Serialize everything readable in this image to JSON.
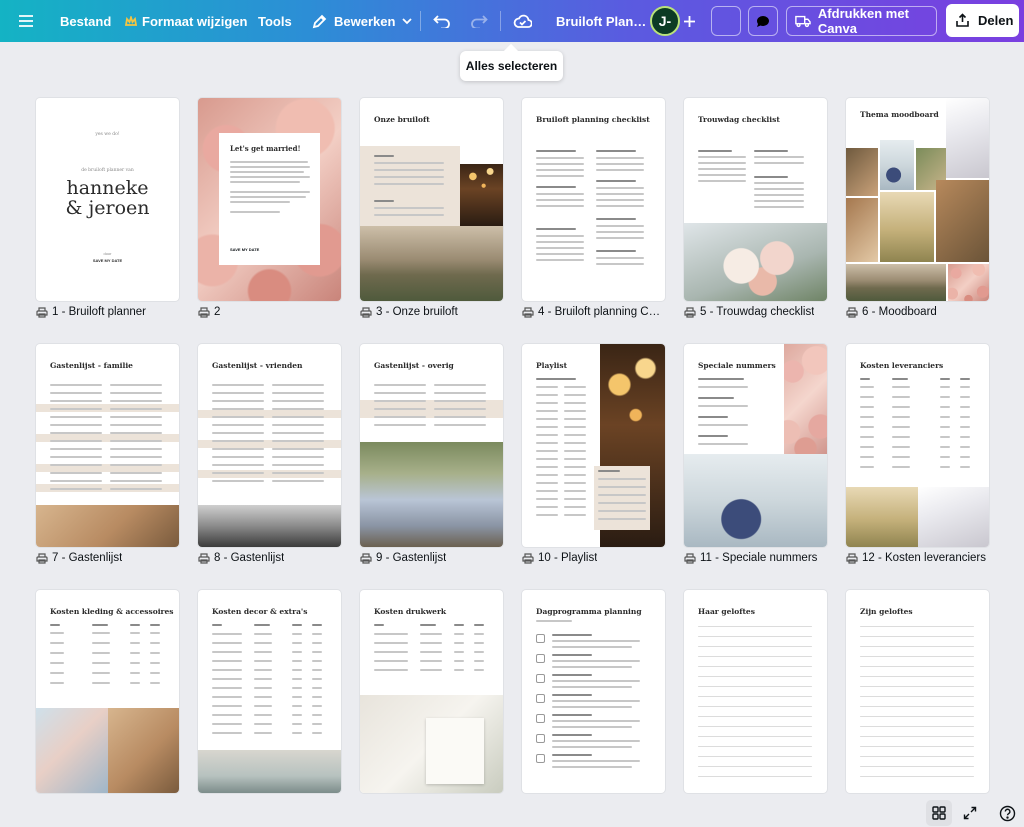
{
  "topbar": {
    "menu_icon": "hamburger-icon",
    "file": "Bestand",
    "resize": "Formaat wijzigen",
    "tools": "Tools",
    "edit": "Bewerken",
    "title": "Bruiloft Plan…",
    "avatar_initials": "J-",
    "print": "Afdrukken met Canva",
    "share": "Delen"
  },
  "tooltip": {
    "text": "Alles selecteren"
  },
  "pages": [
    {
      "label": "1 - Bruiloft planner",
      "title": "hanneke & jeroen"
    },
    {
      "label": "2",
      "title": "Let's get married!"
    },
    {
      "label": "3 - Onze bruiloft",
      "title": "Onze bruiloft"
    },
    {
      "label": "4 - Bruiloft planning Ch…",
      "title": "Bruiloft planning checklist"
    },
    {
      "label": "5 - Trouwdag checklist",
      "title": "Trouwdag checklist"
    },
    {
      "label": "6 - Moodboard",
      "title": "Thema moodboard"
    },
    {
      "label": "7 - Gastenlijst",
      "title": "Gastenlijst - familie"
    },
    {
      "label": "8 - Gastenlijst",
      "title": "Gastenlijst - vrienden"
    },
    {
      "label": "9 - Gastenlijst",
      "title": "Gastenlijst - overig"
    },
    {
      "label": "10 - Playlist",
      "title": "Playlist"
    },
    {
      "label": "11 - Speciale nummers",
      "title": "Speciale nummers"
    },
    {
      "label": "12 - Kosten leveranciers",
      "title": "Kosten leveranciers"
    },
    {
      "label": "",
      "title": "Kosten kleding & accessoires"
    },
    {
      "label": "",
      "title": "Kosten decor & extra's"
    },
    {
      "label": "",
      "title": "Kosten drukwerk"
    },
    {
      "label": "",
      "title": "Dagprogramma planning"
    },
    {
      "label": "",
      "title": "Haar geloftes"
    },
    {
      "label": "",
      "title": "Zijn geloftes"
    }
  ],
  "cover": {
    "subtitle": "de bruiloft planner van",
    "names": "hanneke & jeroen",
    "by": "door",
    "footer": "SAVE MY DATE"
  },
  "page2": {
    "footer": "SAVE MY DATE"
  }
}
